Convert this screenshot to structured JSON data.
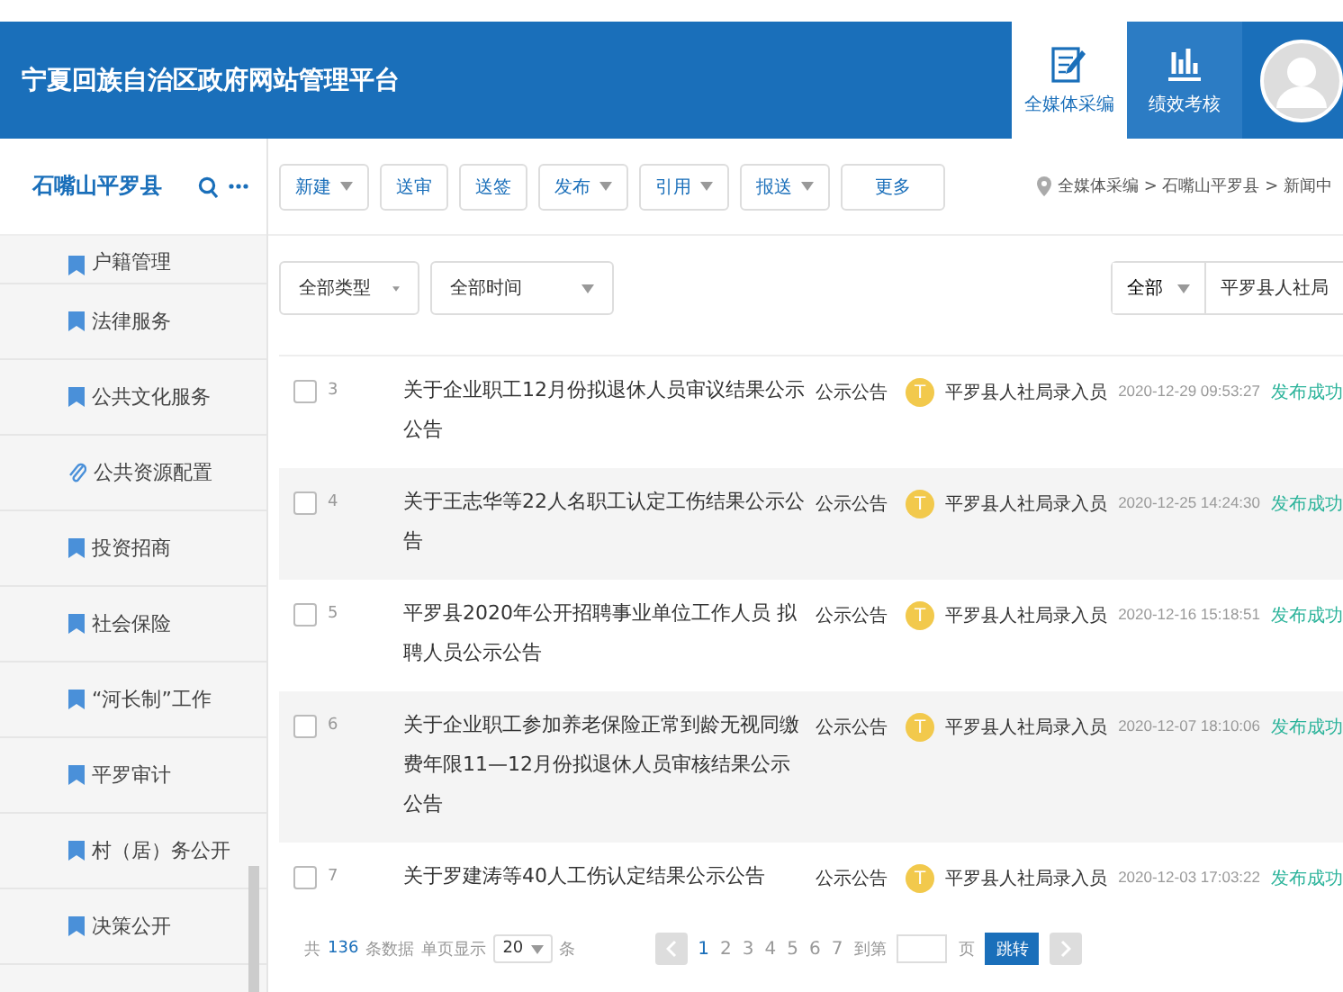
{
  "header": {
    "title": "宁夏回族自治区政府网站管理平台",
    "tabs": [
      {
        "label": "全媒体采编",
        "selected": true,
        "kind": "edit"
      },
      {
        "label": "绩效考核",
        "selected": false,
        "kind": "chart"
      }
    ]
  },
  "sidebar": {
    "title": "石嘴山平罗县",
    "items": [
      {
        "label": "户籍管理",
        "kind": "bookmark"
      },
      {
        "label": "法律服务",
        "kind": "bookmark"
      },
      {
        "label": "公共文化服务",
        "kind": "bookmark"
      },
      {
        "label": "公共资源配置",
        "kind": "link"
      },
      {
        "label": "投资招商",
        "kind": "bookmark"
      },
      {
        "label": "社会保险",
        "kind": "bookmark"
      },
      {
        "label": "“河长制”工作",
        "kind": "bookmark"
      },
      {
        "label": "平罗审计",
        "kind": "bookmark"
      },
      {
        "label": "村（居）务公开",
        "kind": "bookmark"
      },
      {
        "label": "决策公开",
        "kind": "bookmark"
      }
    ]
  },
  "toolbar": {
    "buttons": [
      {
        "label": "新建",
        "menu": true
      },
      {
        "label": "送审",
        "menu": false
      },
      {
        "label": "送签",
        "menu": false
      },
      {
        "label": "发布",
        "menu": true
      },
      {
        "label": "引用",
        "menu": true
      },
      {
        "label": "报送",
        "menu": true
      },
      {
        "label": "更多",
        "menu": false
      }
    ]
  },
  "breadcrumb": "全媒体采编 > 石嘴山平罗县 > 新闻中",
  "filters": {
    "type": "全部类型",
    "time": "全部时间",
    "scope": "全部",
    "unit": "平罗县人社局"
  },
  "rows": [
    {
      "checked": false,
      "number": "3",
      "title": "关于企业职工12月份拟退休人员审议结果公示公告",
      "type": "公示公告",
      "avatar": "T",
      "author": "平罗县人社局录入员",
      "date": "2020-12-29 09:53:27",
      "status": "发布成功"
    },
    {
      "checked": false,
      "number": "4",
      "title": "关于王志华等22人名职工认定工伤结果公示公告",
      "type": "公示公告",
      "avatar": "T",
      "author": "平罗县人社局录入员",
      "date": "2020-12-25 14:24:30",
      "status": "发布成功"
    },
    {
      "checked": false,
      "number": "5",
      "title": "平罗县2020年公开招聘事业单位工作人员 拟聘人员公示公告",
      "type": "公示公告",
      "avatar": "T",
      "author": "平罗县人社局录入员",
      "date": "2020-12-16 15:18:51",
      "status": "发布成功"
    },
    {
      "checked": false,
      "number": "6",
      "title": "关于企业职工参加养老保险正常到龄无视同缴费年限11—12月份拟退休人员审核结果公示公告",
      "type": "公示公告",
      "avatar": "T",
      "author": "平罗县人社局录入员",
      "date": "2020-12-07 18:10:06",
      "status": "发布成功"
    },
    {
      "checked": false,
      "number": "7",
      "title": "关于罗建涛等40人工伤认定结果公示公告",
      "type": "公示公告",
      "avatar": "T",
      "author": "平罗县人社局录入员",
      "date": "2020-12-03 17:03:22",
      "status": "发布成功"
    }
  ],
  "pagination": {
    "total_prefix": "共",
    "total": "136",
    "total_suffix": "条数据",
    "page_size_label": "单页显示",
    "page_size": "20",
    "page_size_unit": "条",
    "pages": [
      {
        "label": "1",
        "selected": true
      },
      {
        "label": "2",
        "selected": false
      },
      {
        "label": "3",
        "selected": false
      },
      {
        "label": "4",
        "selected": false
      },
      {
        "label": "5",
        "selected": false
      },
      {
        "label": "6",
        "selected": false
      },
      {
        "label": "7",
        "selected": false
      }
    ],
    "goto_prefix": "到第",
    "goto_suffix": "页",
    "goto_button": "跳转"
  }
}
